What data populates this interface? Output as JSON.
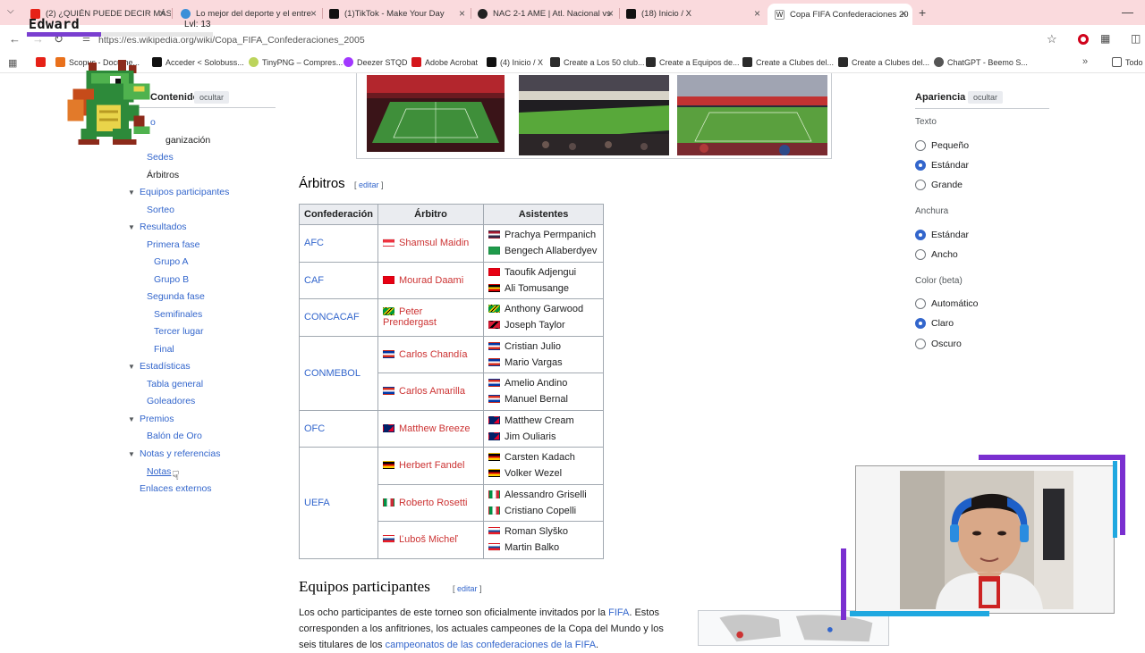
{
  "browser": {
    "tabs": [
      {
        "title": "(2) ¿QUIÉN PUEDE DECIR MÁS",
        "favicon": "youtube-icon",
        "color": "#e62117"
      },
      {
        "title": "Lo mejor del deporte y el entre",
        "favicon": "deporte-icon",
        "color": "#3a8fd8"
      },
      {
        "title": "(1)TikTok - Make Your Day",
        "favicon": "tiktok-icon",
        "color": "#111111"
      },
      {
        "title": "NAC 2-1 AME | Atl. Nacional vs",
        "favicon": "nac-icon",
        "color": "#222222"
      },
      {
        "title": "(18) Inicio / X",
        "favicon": "x-icon",
        "color": "#111111"
      },
      {
        "title": "Copa FIFA Confederaciones 20",
        "favicon": "wikipedia-icon",
        "color": "#444444"
      }
    ],
    "url": "https://es.wikipedia.org/wiki/Copa_FIFA_Confederaciones_2005",
    "bookmarks": [
      {
        "label": "",
        "icon": "youtube-icon"
      },
      {
        "label": "Scopus - Docume...",
        "icon": "scopus-icon"
      },
      {
        "label": "Acceder < Solobuss...",
        "icon": "solobuss-icon"
      },
      {
        "label": "TinyPNG – Compres...",
        "icon": "tinypng-icon"
      },
      {
        "label": "Deezer STQD",
        "icon": "deezer-icon"
      },
      {
        "label": "Adobe Acrobat",
        "icon": "acrobat-icon"
      },
      {
        "label": "(4) Inicio / X",
        "icon": "x-icon"
      },
      {
        "label": "Create a Los 50 club...",
        "icon": "create-icon"
      },
      {
        "label": "Create a Equipos de...",
        "icon": "create-icon"
      },
      {
        "label": "Create a Clubes del...",
        "icon": "create-icon"
      },
      {
        "label": "Create a Clubes del...",
        "icon": "create-icon"
      },
      {
        "label": "ChatGPT - Beemo S...",
        "icon": "chatgpt-icon"
      },
      {
        "label": "Todo",
        "icon": "folder-icon"
      }
    ]
  },
  "overlay": {
    "name": "Edward",
    "level": "Lvl: 13",
    "xp_fraction": 0.4
  },
  "toc": {
    "title": "Contenidos",
    "hide": "ocultar",
    "items": [
      {
        "label": "Sedes"
      },
      {
        "label": "Árbitros"
      },
      {
        "label": "Equipos participantes"
      },
      {
        "label": "Sorteo"
      },
      {
        "label": "Resultados"
      },
      {
        "label": "Primera fase"
      },
      {
        "label": "Grupo A"
      },
      {
        "label": "Grupo B"
      },
      {
        "label": "Segunda fase"
      },
      {
        "label": "Semifinales"
      },
      {
        "label": "Tercer lugar"
      },
      {
        "label": "Final"
      },
      {
        "label": "Estadísticas"
      },
      {
        "label": "Tabla general"
      },
      {
        "label": "Goleadores"
      },
      {
        "label": "Premios"
      },
      {
        "label": "Balón de Oro"
      },
      {
        "label": "Notas y referencias"
      },
      {
        "label": "Notas"
      },
      {
        "label": "Enlaces externos"
      }
    ],
    "partial": [
      "o",
      "ganización"
    ]
  },
  "article": {
    "referees_heading": "Árbitros",
    "edit_label": "editar",
    "table": {
      "headers": [
        "Confederación",
        "Árbitro",
        "Asistentes"
      ],
      "rows": [
        {
          "confederation": "AFC",
          "referees": [
            {
              "name": "Shamsul Maidin",
              "flag": "singapore"
            }
          ],
          "assistants": [
            {
              "name": "Prachya Permpanich",
              "flag": "thailand"
            },
            {
              "name": "Bengech Allaberdyev",
              "flag": "turkmenistan"
            }
          ]
        },
        {
          "confederation": "CAF",
          "referees": [
            {
              "name": "Mourad Daami",
              "flag": "tunisia"
            }
          ],
          "assistants": [
            {
              "name": "Taoufik Adjengui",
              "flag": "tunisia"
            },
            {
              "name": "Ali Tomusange",
              "flag": "uganda"
            }
          ]
        },
        {
          "confederation": "CONCACAF",
          "referees": [
            {
              "name": "Peter Prendergast",
              "flag": "jamaica"
            }
          ],
          "assistants": [
            {
              "name": "Anthony Garwood",
              "flag": "jamaica"
            },
            {
              "name": "Joseph Taylor",
              "flag": "trinidad"
            }
          ]
        },
        {
          "confederation": "CONMEBOL",
          "referees": [
            {
              "name": "Carlos Chandía",
              "flag": "chile"
            },
            {
              "name": "Carlos Amarilla",
              "flag": "paraguay"
            }
          ],
          "assistants": [
            {
              "name": "Cristian Julio",
              "flag": "chile"
            },
            {
              "name": "Mario Vargas",
              "flag": "chile"
            },
            {
              "name": "Amelio Andino",
              "flag": "paraguay"
            },
            {
              "name": "Manuel Bernal",
              "flag": "paraguay"
            }
          ]
        },
        {
          "confederation": "OFC",
          "referees": [
            {
              "name": "Matthew Breeze",
              "flag": "australia"
            }
          ],
          "assistants": [
            {
              "name": "Matthew Cream",
              "flag": "australia"
            },
            {
              "name": "Jim Ouliaris",
              "flag": "australia"
            }
          ]
        },
        {
          "confederation": "UEFA",
          "referees": [
            {
              "name": "Herbert Fandel",
              "flag": "germany"
            },
            {
              "name": "Roberto Rosetti",
              "flag": "italy"
            },
            {
              "name": "Ľuboš Micheľ",
              "flag": "slovakia"
            }
          ],
          "assistants": [
            {
              "name": "Carsten Kadach",
              "flag": "germany"
            },
            {
              "name": "Volker Wezel",
              "flag": "germany"
            },
            {
              "name": "Alessandro Griselli",
              "flag": "italy"
            },
            {
              "name": "Cristiano Copelli",
              "flag": "italy"
            },
            {
              "name": "Roman Slyško",
              "flag": "slovakia"
            },
            {
              "name": "Martin Balko",
              "flag": "slovakia"
            }
          ]
        }
      ]
    },
    "teams_heading": "Equipos participantes",
    "para_line1_a": "Los ocho participantes de este torneo son oficialmente invitados por la ",
    "para_line1_link": "FIFA",
    "para_line1_b": ". Estos",
    "para_line2": "corresponden a los anfitriones, los actuales campeones de la Copa del Mundo y los",
    "para_line3_a": "seis titulares de los ",
    "para_line3_link": "campeonatos de las confederaciones de la FIFA",
    "para_line3_b": "."
  },
  "appearance": {
    "title": "Apariencia",
    "hide": "ocultar",
    "text_label": "Texto",
    "text_options": [
      {
        "label": "Pequeño",
        "selected": false
      },
      {
        "label": "Estándar",
        "selected": true
      },
      {
        "label": "Grande",
        "selected": false
      }
    ],
    "width_label": "Anchura",
    "width_options": [
      {
        "label": "Estándar",
        "selected": true
      },
      {
        "label": "Ancho",
        "selected": false
      }
    ],
    "color_label": "Color (beta)",
    "color_options": [
      {
        "label": "Automático",
        "selected": false
      },
      {
        "label": "Claro",
        "selected": true
      },
      {
        "label": "Oscuro",
        "selected": false
      }
    ]
  },
  "flag_colors": {
    "singapore": [
      "#ef3340",
      "#ffffff"
    ],
    "thailand": [
      "#a51931",
      "#f4f5f8",
      "#2d2a4a"
    ],
    "turkmenistan": [
      "#1f9b4b"
    ],
    "tunisia": [
      "#e70013"
    ],
    "uganda": [
      "#000000",
      "#fcdc04",
      "#d90000"
    ],
    "jamaica": [
      "#009b3a",
      "#fed100",
      "#000000"
    ],
    "trinidad": [
      "#da1a35",
      "#000000"
    ],
    "chile": [
      "#0033a0",
      "#ffffff",
      "#d52b1e"
    ],
    "paraguay": [
      "#d52b1e",
      "#ffffff",
      "#0038a8"
    ],
    "australia": [
      "#012169",
      "#e4002b"
    ],
    "germany": [
      "#000000",
      "#dd0000",
      "#ffce00"
    ],
    "italy": [
      "#009246",
      "#ffffff",
      "#ce2b37"
    ],
    "slovakia": [
      "#ffffff",
      "#0b4ea2",
      "#ee1c25"
    ]
  },
  "colors": {
    "link": "#3366cc",
    "redlink": "#cc3333",
    "tabbar": "#fadadd",
    "overlay_purple": "#7a2fd0",
    "overlay_cyan": "#1fa8e0"
  }
}
